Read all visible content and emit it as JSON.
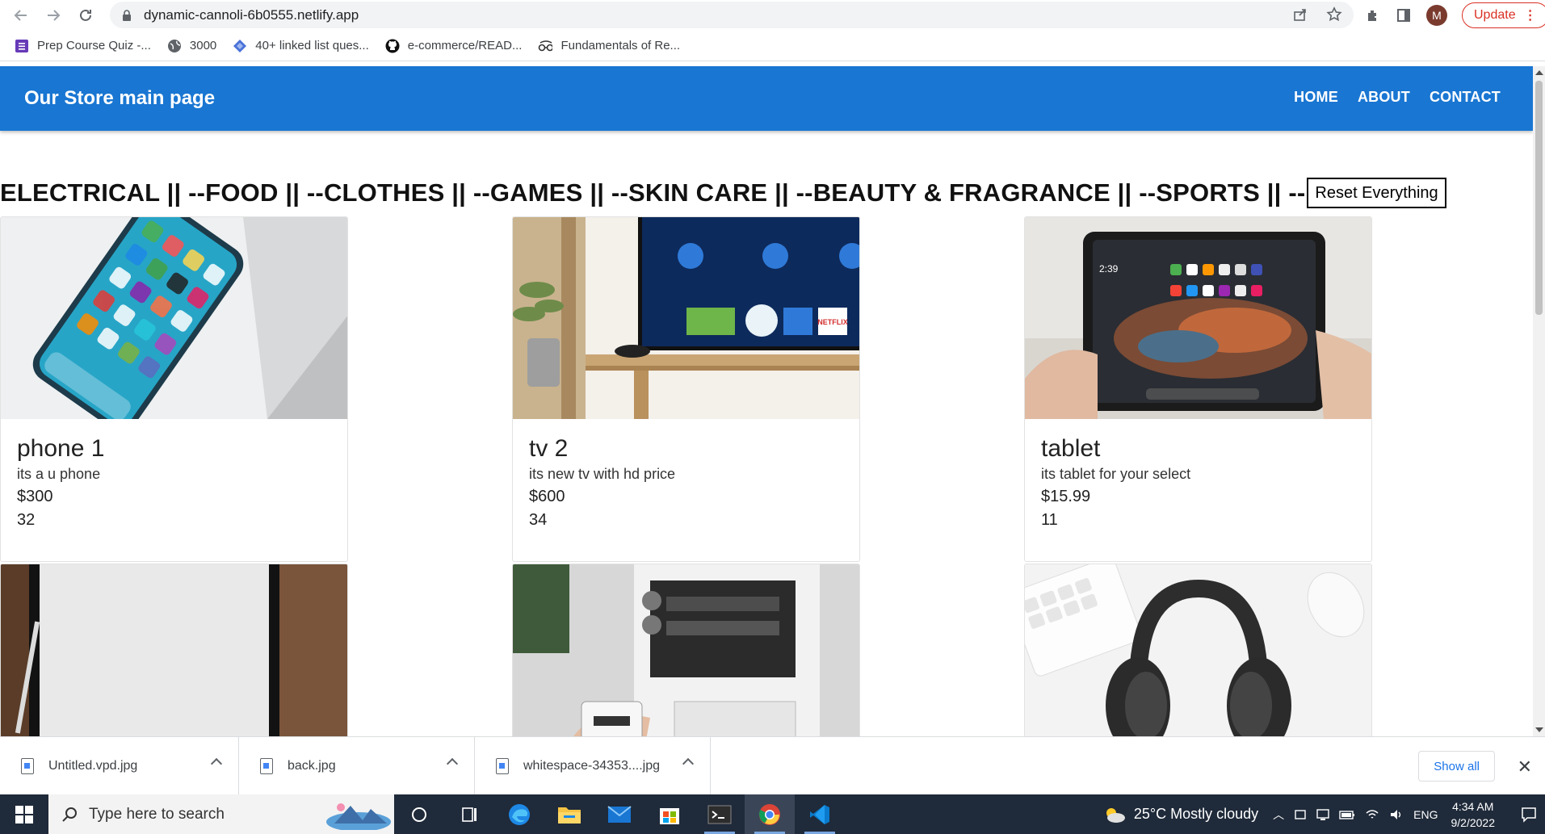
{
  "browser": {
    "url": "dynamic-cannoli-6b0555.netlify.app",
    "avatar_letter": "M",
    "update_label": "Update"
  },
  "bookmarks": [
    {
      "label": "Prep Course Quiz -...",
      "icon": "form-icon"
    },
    {
      "label": "3000",
      "icon": "globe-icon"
    },
    {
      "label": "40+ linked list ques...",
      "icon": "diamond-icon"
    },
    {
      "label": "e-commerce/READ...",
      "icon": "github-icon"
    },
    {
      "label": "Fundamentals of Re...",
      "icon": "glasses-icon"
    }
  ],
  "header": {
    "brand": "Our Store main page",
    "nav": [
      "HOME",
      "ABOUT",
      "CONTACT"
    ]
  },
  "categories": {
    "text": "ELECTRICAL || --FOOD || --CLOTHES || --GAMES || --SKIN CARE || --BEAUTY & FRAGRANCE || --SPORTS || --",
    "reset_label": "Reset Everything"
  },
  "products": [
    {
      "title": "phone 1",
      "desc": "its a u phone",
      "price": "$300",
      "qty": "32",
      "image": "smartphone-on-laptop"
    },
    {
      "title": "tv 2",
      "desc": "its new tv with hd price",
      "price": "$600",
      "qty": "34",
      "image": "tv-on-shelf"
    },
    {
      "title": "tablet",
      "desc": "its tablet for your select",
      "price": "$15.99",
      "qty": "11",
      "image": "tablet-in-hand"
    },
    {
      "title": "",
      "desc": "",
      "price": "",
      "qty": "",
      "image": "tablet-on-wood"
    },
    {
      "title": "",
      "desc": "",
      "price": "",
      "qty": "",
      "image": "pc-build"
    },
    {
      "title": "",
      "desc": "",
      "price": "",
      "qty": "",
      "image": "headphones-desk"
    }
  ],
  "downloads": {
    "items": [
      "Untitled.vpd.jpg",
      "back.jpg",
      "whitespace-34353....jpg"
    ],
    "show_all": "Show all"
  },
  "taskbar": {
    "search_placeholder": "Type here to search",
    "weather": "25°C  Mostly cloudy",
    "language": "ENG",
    "time": "4:34 AM",
    "date": "9/2/2022"
  }
}
